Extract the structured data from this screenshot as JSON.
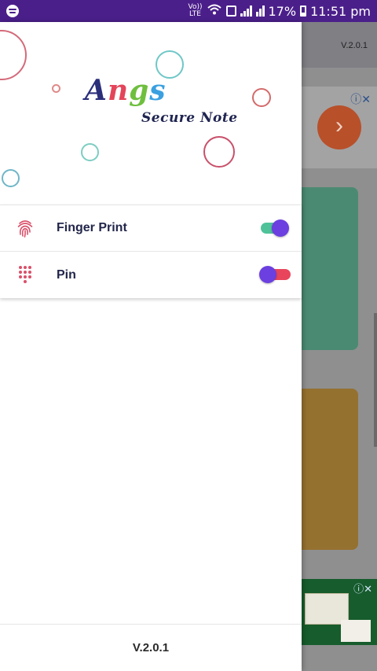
{
  "status_bar": {
    "volte": "Vo))",
    "lte": "LTE",
    "battery": "17%",
    "time": "11:51 pm"
  },
  "drawer": {
    "logo": {
      "letters": [
        "A",
        "n",
        "g",
        "s"
      ],
      "colors": [
        "#2b2f7a",
        "#e4455a",
        "#6fbf3f",
        "#3aa0e0"
      ]
    },
    "subtitle": "Secure Note",
    "menu": [
      {
        "label": "Finger Print",
        "icon": "fingerprint-icon",
        "toggle_on": true
      },
      {
        "label": "Pin",
        "icon": "dialpad-icon",
        "toggle_on": false
      }
    ],
    "footer_version": "V.2.0.1"
  },
  "background": {
    "toolbar_version": "V.2.0.1",
    "ad_info": "ⓘ✕"
  },
  "colors": {
    "status_bar": "#4b1f8a",
    "toggle_thumb": "#6b3fe0",
    "toggle_on_track": "#4fc29a",
    "toggle_off_track": "#e8455c",
    "icon_red": "#d9506a"
  }
}
